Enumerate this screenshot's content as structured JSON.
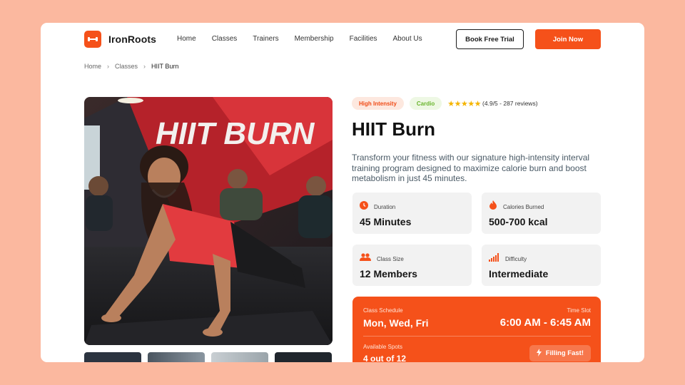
{
  "brand": {
    "name": "IronRoots"
  },
  "nav": [
    "Home",
    "Classes",
    "Trainers",
    "Membership",
    "Facilities",
    "About Us"
  ],
  "header": {
    "trial_label": "Book Free Trial",
    "join_label": "Join Now"
  },
  "breadcrumb": {
    "home": "Home",
    "classes": "Classes",
    "current": "HIIT Burn"
  },
  "hero": {
    "sign_text": "HIIT BURN"
  },
  "tags": {
    "intensity": "High Intensity",
    "cardio": "Cardio"
  },
  "rating": {
    "stars": 5,
    "text": "(4.9/5 - 287 reviews)"
  },
  "class": {
    "title": "HIIT Burn",
    "description": "Transform your fitness with our signature high-intensity interval training program designed to maximize calorie burn and boost metabolism in just 45 minutes."
  },
  "stats": {
    "duration": {
      "label": "Duration",
      "value": "45 Minutes",
      "icon": "clock-icon"
    },
    "calories": {
      "label": "Calories Burned",
      "value": "500-700 kcal",
      "icon": "flame-icon"
    },
    "class_size": {
      "label": "Class Size",
      "value": "12 Members",
      "icon": "users-icon"
    },
    "difficulty": {
      "label": "Difficulty",
      "value": "Intermediate",
      "icon": "signal-bars-icon"
    }
  },
  "schedule": {
    "label": "Class Schedule",
    "days": "Mon, Wed, Fri",
    "time_label": "Time Slot",
    "time": "6:00 AM - 6:45 AM",
    "spots_label": "Available Spots",
    "spots": "4 out of 12",
    "status": "Filling Fast!"
  },
  "colors": {
    "accent": "#f5511a",
    "background": "#fbb89f",
    "card": "#ffffff"
  }
}
